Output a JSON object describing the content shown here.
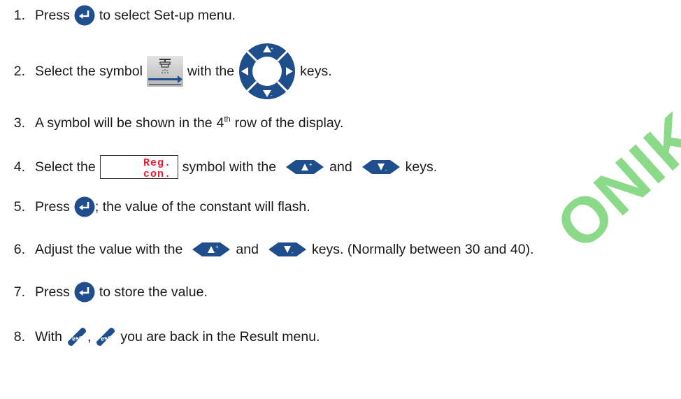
{
  "colors": {
    "key_blue": "#1f4e8c",
    "reg_red": "#e8192c",
    "watermark": "#7ed67e"
  },
  "steps": [
    {
      "num": "1.",
      "a": "Press",
      "b": "to select Set-up menu."
    },
    {
      "num": "2.",
      "a": "Select the symbol",
      "b": "with the",
      "c": "keys."
    },
    {
      "num": "3.",
      "a": "A symbol will be shown in the",
      "ord": "4",
      "sup": "th",
      "b": "row of the display."
    },
    {
      "num": "4.",
      "a": "Select the",
      "b": "symbol with the",
      "c": "and",
      "d": "keys."
    },
    {
      "num": "5.",
      "a": "Press",
      "b": "; the value of the constant will flash."
    },
    {
      "num": "6.",
      "a": "Adjust the value with the",
      "b": "and",
      "c": "keys. (Normally between 30 and 40)."
    },
    {
      "num": "7.",
      "a": "Press",
      "b": "to store the value."
    },
    {
      "num": "8.",
      "a": "With",
      "sep": ",",
      "b": "you are back in the Result menu."
    }
  ],
  "display": {
    "line1": "Reg.",
    "line2": "con."
  },
  "key_labels": {
    "esc": "esc"
  },
  "icons": [
    "enter-key-icon",
    "sprayer-track-icon",
    "four-way-arrow-keys-icon",
    "arrow-up-key-icon",
    "arrow-down-key-icon",
    "esc-key-icon"
  ],
  "watermark": "ONIK"
}
